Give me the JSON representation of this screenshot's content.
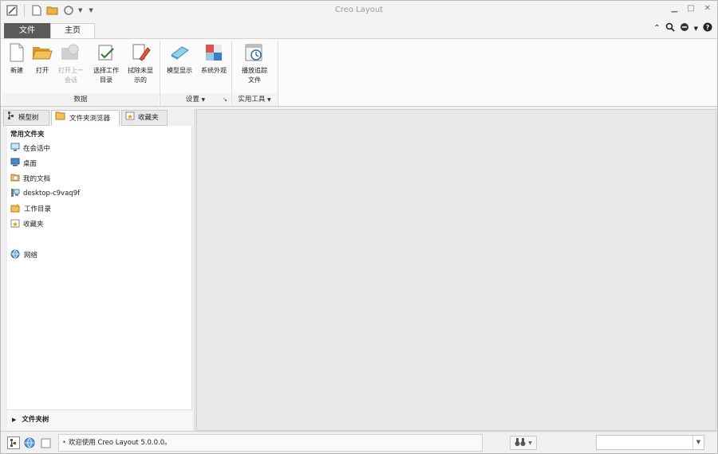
{
  "window": {
    "title": "Creo Layout"
  },
  "quick_access": {
    "icons": [
      "edit-window-icon",
      "new-file-icon",
      "open-folder-icon",
      "regenerate-icon",
      "customize-dropdown-icon"
    ]
  },
  "tabs": {
    "file": "文件",
    "home": "主页"
  },
  "ribbon": {
    "groups": {
      "data": "数据",
      "settings": "设置",
      "utilities": "实用工具"
    },
    "buttons": {
      "new": {
        "label": "新建"
      },
      "open": {
        "label": "打开"
      },
      "open_last_line1": "打开上一",
      "open_last_line2": "会话",
      "select_wd_line1": "选择工作",
      "select_wd_line2": "目录",
      "erase_line1": "拭除未显",
      "erase_line2": "示的",
      "model_display": {
        "label": "模型显示"
      },
      "system_appearance": {
        "label": "系统外观"
      },
      "play_trail_line1": "播放追踪",
      "play_trail_line2": "文件"
    }
  },
  "navigator": {
    "tabs": {
      "model_tree": "模型树",
      "folder_browser": "文件夹浏览器",
      "favorites": "收藏夹"
    },
    "section_title": "常用文件夹",
    "items": [
      {
        "label": "在会话中",
        "icon": "monitor-icon"
      },
      {
        "label": "桌面",
        "icon": "desktop-icon"
      },
      {
        "label": "我的文档",
        "icon": "documents-folder-icon"
      },
      {
        "label": "desktop-c9vaq9f",
        "icon": "computer-icon"
      },
      {
        "label": "工作目录",
        "icon": "working-directory-icon"
      },
      {
        "label": "收藏夹",
        "icon": "favorites-folder-icon"
      },
      {
        "label": "网络",
        "icon": "network-icon"
      }
    ],
    "footer": "文件夹树"
  },
  "status": {
    "message": "欢迎使用 Creo Layout 5.0.0.0。"
  },
  "colors": {
    "file_tab_bg": "#5a5a5a",
    "canvas_bg": "#e9e9e9"
  }
}
